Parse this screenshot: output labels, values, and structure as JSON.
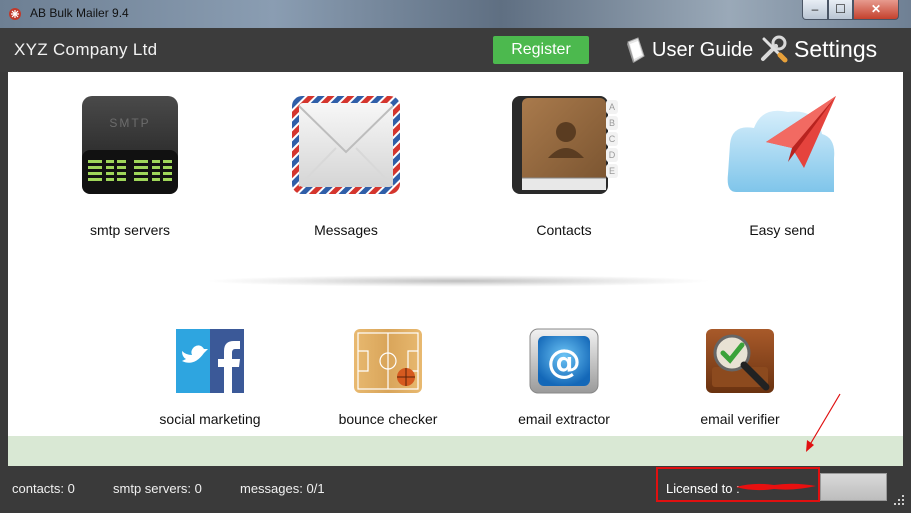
{
  "window": {
    "title": "AB Bulk Mailer 9.4",
    "controls": {
      "minimize": "–",
      "maximize": "☐",
      "close": "✕"
    }
  },
  "header": {
    "company": "XYZ Company Ltd",
    "register_label": "Register",
    "user_guide_label": "User Guide",
    "settings_label": "Settings"
  },
  "tiles_top": [
    {
      "label": "smtp servers",
      "icon": "smtp-server-icon"
    },
    {
      "label": "Messages",
      "icon": "envelope-icon"
    },
    {
      "label": "Contacts",
      "icon": "address-book-icon"
    },
    {
      "label": "Easy send",
      "icon": "paper-plane-icon"
    }
  ],
  "tiles_bottom": [
    {
      "label": "social marketing",
      "icon": "social-media-icon"
    },
    {
      "label": "bounce checker",
      "icon": "basketball-court-icon"
    },
    {
      "label": "email extractor",
      "icon": "at-sign-icon"
    },
    {
      "label": "email verifier",
      "icon": "magnifier-check-icon"
    }
  ],
  "smtp_icon_text": "SMTP",
  "address_book_tabs": [
    "A",
    "B",
    "C",
    "D",
    "E"
  ],
  "status": {
    "contacts": "contacts: 0",
    "smtp_servers": "smtp servers: 0",
    "messages": "messages: 0/1",
    "license": "Licensed to :"
  },
  "colors": {
    "header_bg": "#3c3c3c",
    "register_green": "#4cb94e",
    "annotation_red": "#e01010",
    "strip_green": "#d9e8d4"
  }
}
